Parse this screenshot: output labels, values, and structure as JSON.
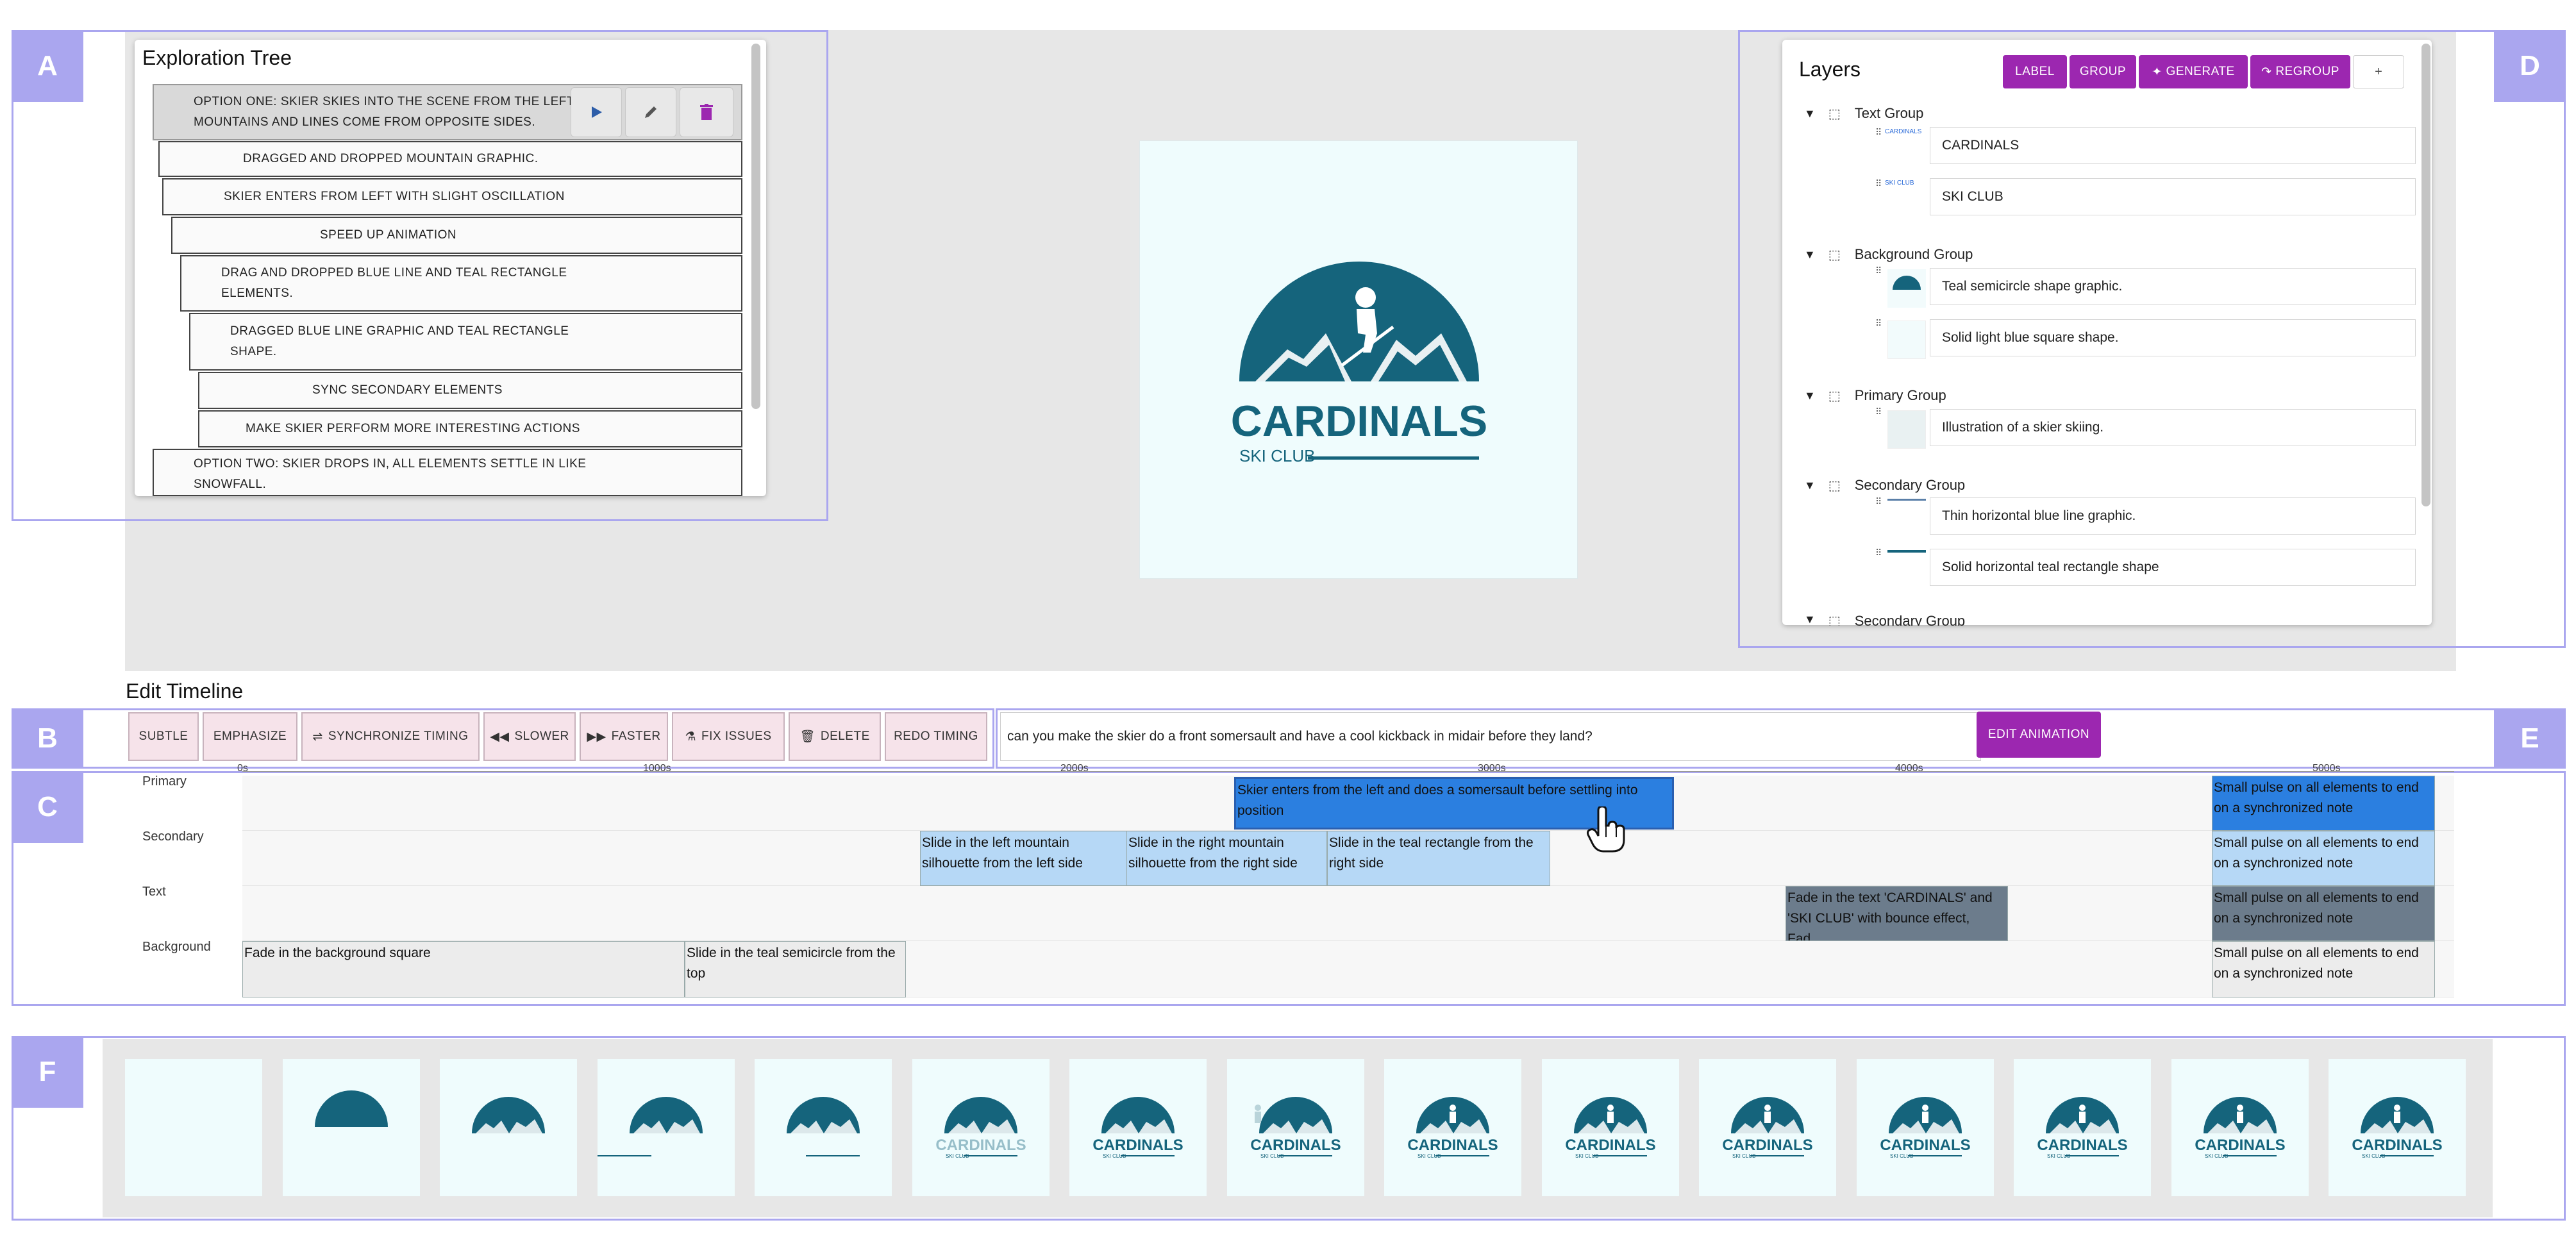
{
  "regions": {
    "a": "A",
    "b": "B",
    "c": "C",
    "d": "D",
    "e": "E",
    "f": "F"
  },
  "tree": {
    "title": "Exploration Tree",
    "nodes": [
      "OPTION ONE: SKIER SKIES INTO THE SCENE FROM THE LEFT,",
      "MOUNTAINS AND LINES COME FROM OPPOSITE SIDES.",
      "DRAGGED AND DROPPED MOUNTAIN GRAPHIC.",
      "SKIER ENTERS FROM LEFT WITH SLIGHT OSCILLATION",
      "SPEED UP ANIMATION",
      "DRAG AND DROPPED BLUE LINE AND TEAL RECTANGLE",
      "ELEMENTS.",
      "DRAGGED BLUE LINE GRAPHIC AND TEAL RECTANGLE",
      "SHAPE.",
      "SYNC SECONDARY ELEMENTS",
      "MAKE SKIER PERFORM MORE INTERESTING ACTIONS",
      "OPTION TWO: SKIER DROPS IN, ALL ELEMENTS SETTLE IN LIKE",
      "SNOWFALL."
    ],
    "actions": {
      "play": "play-icon",
      "edit": "pencil-icon",
      "delete": "trash-icon"
    }
  },
  "artboard": {
    "brand": "CARDINALS",
    "sub": "SKI CLUB"
  },
  "colors": {
    "teal": "#15647c",
    "accent": "#9c27b0",
    "region": "#aaa6ef",
    "artboard": "#effcfd"
  },
  "layers": {
    "title": "Layers",
    "buttons": [
      "LABEL",
      "GROUP",
      "GENERATE",
      "REGROUP",
      "+"
    ],
    "groups": [
      {
        "name": "Text Group",
        "items": [
          "CARDINALS",
          "SKI CLUB"
        ]
      },
      {
        "name": "Background Group",
        "items": [
          "Teal semicircle shape graphic.",
          "Solid light blue square shape."
        ]
      },
      {
        "name": "Primary Group",
        "items": [
          "Illustration of a skier skiing."
        ]
      },
      {
        "name": "Secondary Group",
        "items": [
          "Thin horizontal blue line graphic.",
          "Solid horizontal teal rectangle shape"
        ]
      },
      {
        "name": "Secondary Group",
        "items": []
      }
    ],
    "thumb_text": [
      "CARDINALS",
      "SKI CLUB"
    ]
  },
  "timeline": {
    "title": "Edit Timeline",
    "chips": [
      "SUBTLE",
      "EMPHASIZE",
      "SYNCHRONIZE TIMING",
      "SLOWER",
      "FASTER",
      "FIX ISSUES",
      "DELETE",
      "REDO TIMING"
    ],
    "prompt": "can you make the skier do a front somersault and have a cool kickback in midair before they land?",
    "edit_button": "EDIT ANIMATION",
    "ruler": [
      "0s",
      "1000s",
      "2000s",
      "3000s",
      "4000s",
      "5000s"
    ],
    "tracks": [
      "Primary",
      "Secondary",
      "Text",
      "Background"
    ],
    "clips": {
      "p1": "Skier enters from the left and does a somersault before settling into position",
      "p2": "Small pulse on all elements to end on a synchronized note",
      "s1": "Slide in the left mountain silhouette from the left side",
      "s2": "Slide in the right mountain silhouette from the right side",
      "s3": "Slide in the teal rectangle from the right side",
      "s4": "Small pulse on all elements to end on a synchronized note",
      "t1": "Fade in the text 'CARDINALS' and 'SKI CLUB' with bounce effect, Fad...",
      "t2": "Small pulse on all elements to end on a synchronized note",
      "b1": "Fade in the background square",
      "b2": "Slide in the teal semicircle from the top",
      "b3": "Small pulse on all elements to end on a synchronized note"
    }
  },
  "filmstrip": {
    "frame_count": 15,
    "brand": "CARDINALS",
    "sub": "SKI CLUB"
  }
}
